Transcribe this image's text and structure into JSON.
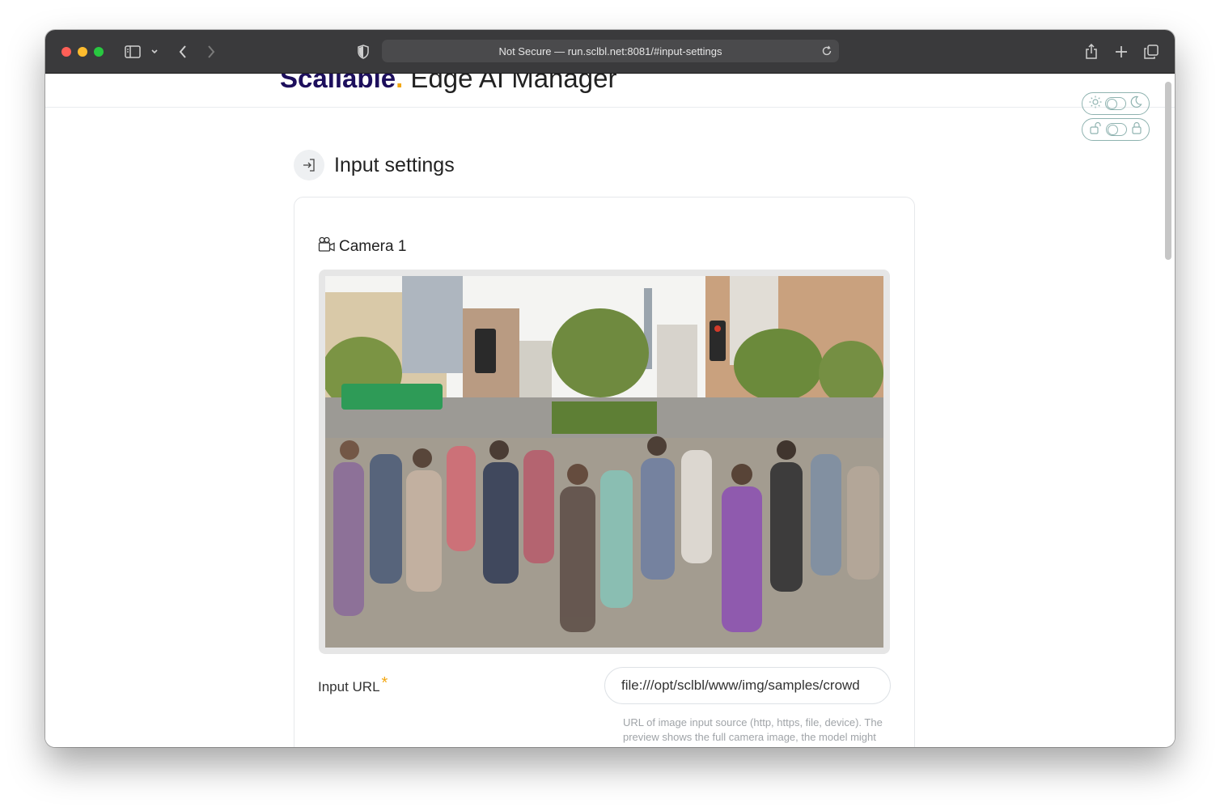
{
  "browser": {
    "address": "Not Secure — run.sclbl.net:8081/#input-settings"
  },
  "brand": {
    "name": "Scailable",
    "dot": ".",
    "product": " Edge AI Manager"
  },
  "section": {
    "title": "Input settings"
  },
  "camera": {
    "title": "Camera 1",
    "preview_subject": "crowd crossing street"
  },
  "input_url": {
    "label": "Input URL",
    "required_mark": "*",
    "value": "file:///opt/sclbl/www/img/samples/crowd",
    "help": "URL of image input source (http, https, file, device). The preview shows the full camera image, the model might"
  },
  "colors": {
    "brand": "#1d0f5c",
    "accent": "#f3a712",
    "toggle_border": "#8fb3b0"
  }
}
